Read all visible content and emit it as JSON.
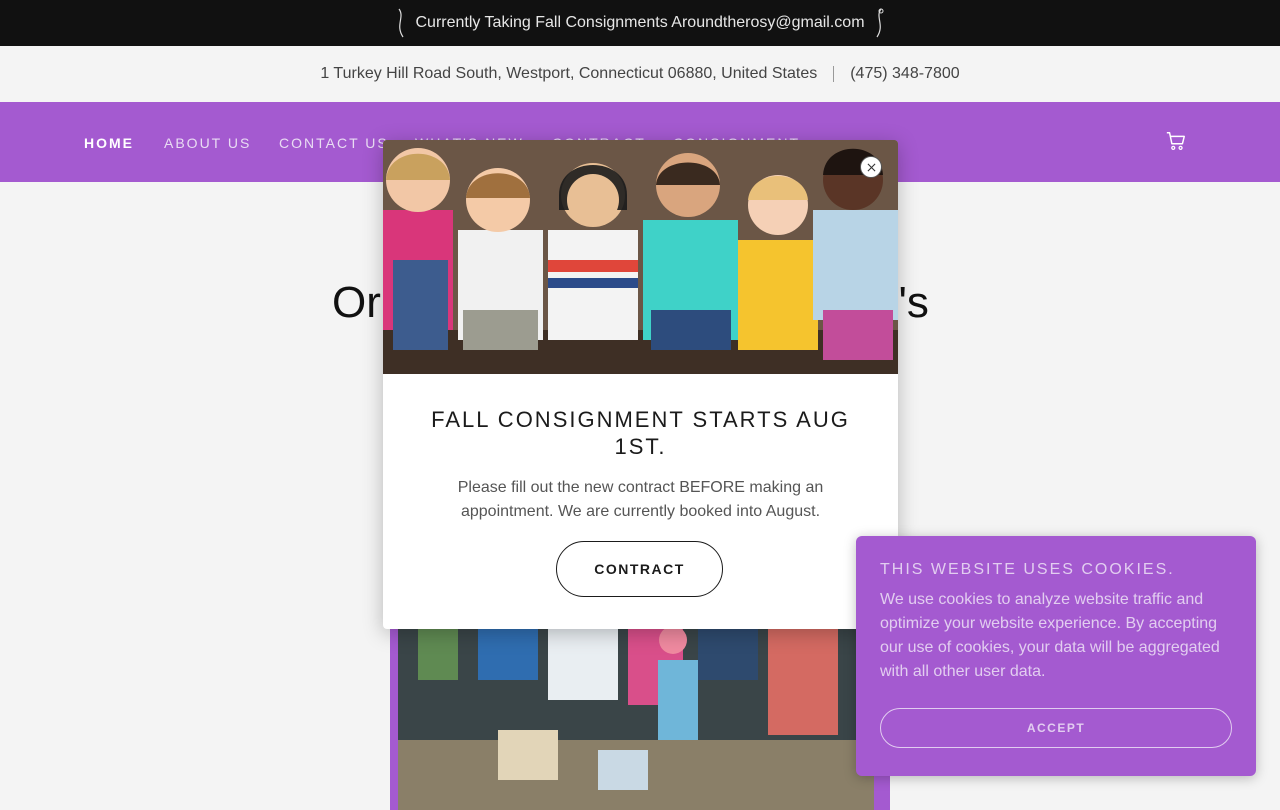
{
  "announcement": {
    "text": "Currently Taking Fall Consignments Aroundtherosy@gmail.com"
  },
  "address_bar": {
    "address": "1 Turkey Hill Road South, Westport, Connecticut 06880, United States",
    "phone": "(475) 348-7800"
  },
  "nav": {
    "items": [
      {
        "label": "HOME",
        "active": true
      },
      {
        "label": "ABOUT US"
      },
      {
        "label": "CONTACT US"
      },
      {
        "label": "WHAT'S NEW"
      },
      {
        "label": "CONTRACT"
      },
      {
        "label": "CONSIGNMENT"
      }
    ],
    "cart_icon": "cart-icon",
    "color": "#a45ad0"
  },
  "hero": {
    "title_left": "Or",
    "title_right": "n's"
  },
  "modal": {
    "title": "FALL CONSIGNMENT STARTS AUG 1ST.",
    "text": "Please fill out the new contract BEFORE making an appointment. We are currently booked into August.",
    "button": "CONTRACT",
    "close_icon": "close-icon"
  },
  "cookie_banner": {
    "title": "THIS WEBSITE USES COOKIES.",
    "text": "We use cookies to analyze website traffic and optimize your website experience. By accepting our use of cookies, your data will be aggregated with all other user data.",
    "button": "ACCEPT",
    "color": "#a45ad0"
  }
}
